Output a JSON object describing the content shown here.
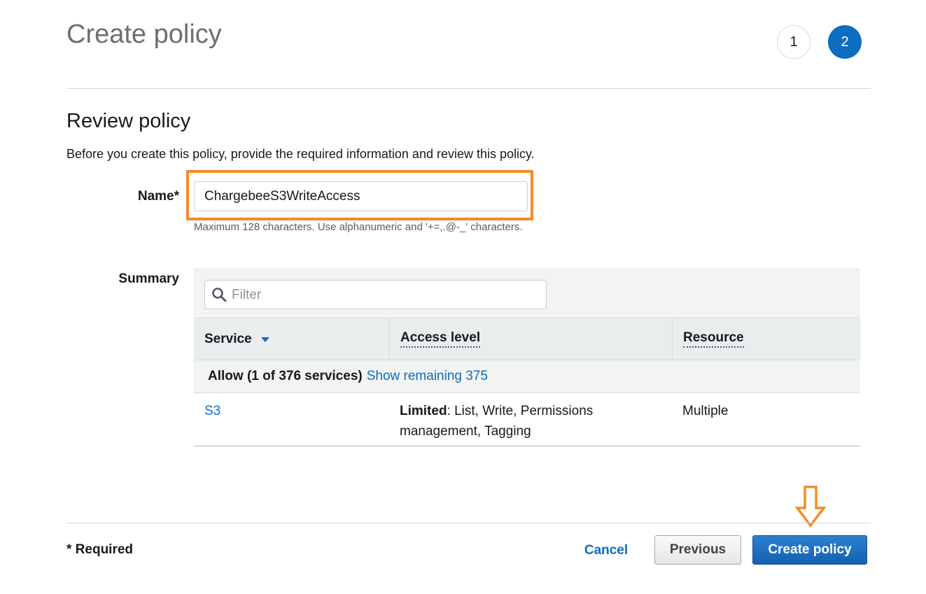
{
  "page": {
    "title": "Create policy",
    "steps": [
      "1",
      "2"
    ],
    "active_step": 2
  },
  "review": {
    "heading": "Review policy",
    "description": "Before you create this policy, provide the required information and review this policy."
  },
  "name_field": {
    "label": "Name*",
    "value": "ChargebeeS3WriteAccess",
    "hint": "Maximum 128 characters. Use alphanumeric and '+=,.@-_' characters."
  },
  "summary": {
    "label": "Summary",
    "filter_placeholder": "Filter",
    "columns": [
      "Service",
      "Access level",
      "Resource"
    ],
    "group": {
      "text": "Allow (1 of 376 services)",
      "link": "Show remaining 375"
    },
    "rows": [
      {
        "service": "S3",
        "access_level_bold": "Limited",
        "access_level_rest": ": List, Write, Permissions management, Tagging",
        "resource": "Multiple"
      }
    ]
  },
  "footer": {
    "required_note": "* Required",
    "cancel_label": "Cancel",
    "previous_label": "Previous",
    "create_label": "Create policy"
  },
  "icons": {
    "search": "search-icon",
    "sort": "caret-down-icon",
    "annotation_arrow": "arrow-down-icon"
  },
  "colors": {
    "accent_blue": "#0d6ebf",
    "highlight_orange": "#f58b26",
    "primary_button": "#1a67b8"
  }
}
